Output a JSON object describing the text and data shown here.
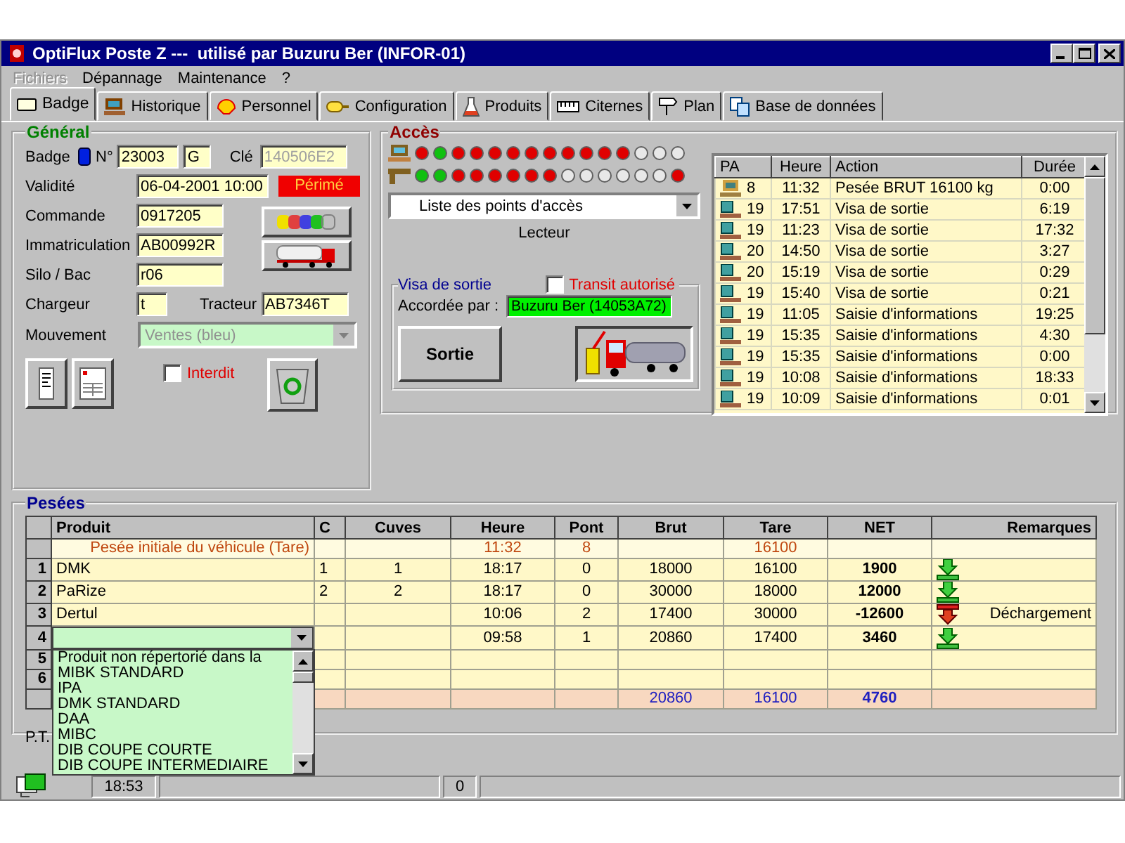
{
  "window": {
    "title": "OptiFlux Poste Z ---  utilisé par Buzuru Ber (INFOR-01)"
  },
  "menu": [
    {
      "label": "Fichiers",
      "disabled": true
    },
    {
      "label": "Dépannage",
      "disabled": false
    },
    {
      "label": "Maintenance",
      "disabled": false
    },
    {
      "label": "?",
      "disabled": false
    }
  ],
  "tabs": [
    {
      "label": "Badge",
      "kind": "card",
      "selected": true
    },
    {
      "label": "Historique",
      "kind": "monitor",
      "selected": false
    },
    {
      "label": "Personnel",
      "kind": "shell",
      "selected": false
    },
    {
      "label": "Configuration",
      "kind": "plug",
      "selected": false
    },
    {
      "label": "Produits",
      "kind": "flask",
      "selected": false
    },
    {
      "label": "Citernes",
      "kind": "tank",
      "selected": false
    },
    {
      "label": "Plan",
      "kind": "signpost",
      "selected": false
    },
    {
      "label": "Base de données",
      "kind": "documents",
      "selected": false
    }
  ],
  "general": {
    "title": "Général",
    "badge_label": "Badge",
    "number_label": "N°",
    "number": "23003",
    "letter": "G",
    "key_label": "Clé",
    "key": "140506E2",
    "validity_label": "Validité",
    "validity": "06-04-2001 10:00",
    "status": "Périmé",
    "order_label": "Commande",
    "order": "0917205",
    "plate_label": "Immatriculation",
    "plate": "AB00992R",
    "silo_label": "Silo / Bac",
    "silo": "r06",
    "loader_label": "Chargeur",
    "loader": "t",
    "tractor_label": "Tracteur",
    "tractor": "AB7346T",
    "movement_label": "Mouvement",
    "movement": "Ventes (bleu)",
    "forbidden": {
      "label": "Interdit",
      "checked": false
    }
  },
  "access": {
    "title": "Accès",
    "computer_leds": [
      {
        "color": "#e00000"
      },
      {
        "color": "#10c010"
      },
      {
        "color": "#e00000"
      },
      {
        "color": "#e00000"
      },
      {
        "color": "#e00000"
      },
      {
        "color": "#e00000"
      },
      {
        "color": "#e00000"
      },
      {
        "color": "#e00000"
      },
      {
        "color": "#e00000"
      },
      {
        "color": "#e00000"
      },
      {
        "color": "#e00000"
      },
      {
        "color": "#e00000"
      },
      {
        "color": "#e8e8e8"
      },
      {
        "color": "#e8e8e8"
      },
      {
        "color": "#e8e8e8"
      }
    ],
    "reader_leds": [
      {
        "color": "#10c010"
      },
      {
        "color": "#10c010"
      },
      {
        "color": "#e00000"
      },
      {
        "color": "#e00000"
      },
      {
        "color": "#e00000"
      },
      {
        "color": "#e00000"
      },
      {
        "color": "#e00000"
      },
      {
        "color": "#e00000"
      },
      {
        "color": "#e8e8e8"
      },
      {
        "color": "#e8e8e8"
      },
      {
        "color": "#e8e8e8"
      },
      {
        "color": "#e8e8e8"
      },
      {
        "color": "#e8e8e8"
      },
      {
        "color": "#e8e8e8"
      },
      {
        "color": "#e00000"
      }
    ],
    "access_points": "Liste des points d'accès",
    "reader_label": "Lecteur",
    "exit_visa": {
      "title": "Visa de sortie",
      "transit": {
        "label": "Transit autorisé",
        "checked": false
      },
      "granted_label": "Accordée par :",
      "granted_by": "Buzuru Ber (14053A72)",
      "exit_button": "Sortie"
    }
  },
  "history": {
    "columns": [
      "PA",
      "Heure",
      "Action",
      "Durée"
    ],
    "rows": [
      {
        "kind": "computer",
        "pa": "8",
        "time": "11:32",
        "action": "Pesée BRUT 16100 kg",
        "duration": "0:00"
      },
      {
        "kind": "terminal",
        "pa": "19",
        "time": "17:51",
        "action": "Visa de sortie",
        "duration": "6:19"
      },
      {
        "kind": "terminal",
        "pa": "19",
        "time": "11:23",
        "action": "Visa de sortie",
        "duration": "17:32"
      },
      {
        "kind": "terminal",
        "pa": "20",
        "time": "14:50",
        "action": "Visa de sortie",
        "duration": "3:27"
      },
      {
        "kind": "terminal",
        "pa": "20",
        "time": "15:19",
        "action": "Visa de sortie",
        "duration": "0:29"
      },
      {
        "kind": "terminal",
        "pa": "19",
        "time": "15:40",
        "action": "Visa de sortie",
        "duration": "0:21"
      },
      {
        "kind": "terminal",
        "pa": "19",
        "time": "11:05",
        "action": "Saisie d'informations",
        "duration": "19:25"
      },
      {
        "kind": "terminal",
        "pa": "19",
        "time": "15:35",
        "action": "Saisie d'informations",
        "duration": "4:30"
      },
      {
        "kind": "terminal",
        "pa": "19",
        "time": "15:35",
        "action": "Saisie d'informations",
        "duration": "0:00"
      },
      {
        "kind": "terminal",
        "pa": "19",
        "time": "10:08",
        "action": "Saisie d'informations",
        "duration": "18:33"
      },
      {
        "kind": "terminal",
        "pa": "19",
        "time": "10:09",
        "action": "Saisie d'informations",
        "duration": "0:01"
      }
    ]
  },
  "weighings": {
    "title": "Pesées",
    "columns": [
      "Produit",
      "C",
      "Cuves",
      "Heure",
      "Pont",
      "Brut",
      "Tare",
      "NET",
      "Remarques"
    ],
    "tare_row": {
      "product": "Pesée initiale du véhicule (Tare)",
      "time": "11:32",
      "bridge": "8",
      "tare": "16100"
    },
    "rows": [
      {
        "index": "1",
        "editing": false,
        "product": "DMK",
        "c": "1",
        "tanks": "1",
        "time": "18:17",
        "bridge": "0",
        "gross": "18000",
        "tare": "16100",
        "net": "1900",
        "kind": "load"
      },
      {
        "index": "2",
        "editing": false,
        "product": "PaRize",
        "c": "2",
        "tanks": "2",
        "time": "18:17",
        "bridge": "0",
        "gross": "30000",
        "tare": "18000",
        "net": "12000",
        "kind": "load"
      },
      {
        "index": "3",
        "editing": false,
        "product": "Dertul",
        "time": "10:06",
        "bridge": "2",
        "gross": "17400",
        "tare": "30000",
        "net": "-12600",
        "kind": "unload",
        "remark": "Déchargement"
      },
      {
        "index": "4",
        "editing": true,
        "time": "09:58",
        "bridge": "1",
        "gross": "20860",
        "tare": "17400",
        "net": "3460",
        "kind": "load"
      },
      {
        "index": "5",
        "editing": false
      },
      {
        "index": "6",
        "editing": false
      }
    ],
    "total": {
      "gross": "20860",
      "tare": "16100",
      "net": "4760"
    },
    "product_options": [
      "Produit non répertorié dans la",
      "MIBK STANDARD",
      "IPA",
      "DMK STANDARD",
      "DAA",
      "MIBC",
      "DIB COUPE COURTE",
      "DIB COUPE INTERMEDIAIRE"
    ],
    "pt_label": "P.T."
  },
  "status_bar": {
    "time": "18:53",
    "count": "0"
  }
}
